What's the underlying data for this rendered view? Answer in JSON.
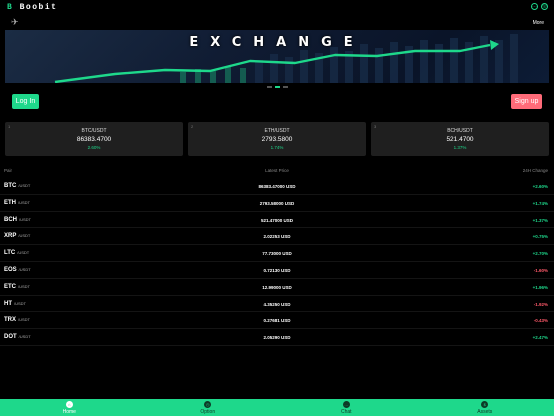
{
  "header": {
    "logo_mark": "B",
    "logo_text": "Boobit",
    "icons": [
      "chat-icon",
      "globe-icon"
    ],
    "rocket_icon": "rocket-icon",
    "more_label": "More"
  },
  "banner": {
    "title": "EXCHANGE",
    "slides": 3,
    "active_slide": 1
  },
  "auth": {
    "login_label": "Log In",
    "signup_label": "Sign up"
  },
  "tickers": [
    {
      "index": "1",
      "pair": "BTC/USDT",
      "price": "86383.4700",
      "change": "2.60%"
    },
    {
      "index": "2",
      "pair": "ETH/USDT",
      "price": "2793.5800",
      "change": "1.74%"
    },
    {
      "index": "3",
      "pair": "BCH/USDT",
      "price": "521.4700",
      "change": "1.37%"
    }
  ],
  "table": {
    "headers": {
      "pair": "Pair",
      "price": "Latest Price",
      "change": "24H Change"
    },
    "rows": [
      {
        "base": "BTC",
        "quote": "/USDT",
        "price": "86383.47000 USD",
        "change": "+2.60%",
        "dir": "up"
      },
      {
        "base": "ETH",
        "quote": "/USDT",
        "price": "2793.58000 USD",
        "change": "+1.74%",
        "dir": "up"
      },
      {
        "base": "BCH",
        "quote": "/USDT",
        "price": "521.47000 USD",
        "change": "+1.37%",
        "dir": "up"
      },
      {
        "base": "XRP",
        "quote": "/USDT",
        "price": "2.02253 USD",
        "change": "+0.75%",
        "dir": "up"
      },
      {
        "base": "LTC",
        "quote": "/USDT",
        "price": "77.73000 USD",
        "change": "+2.70%",
        "dir": "up"
      },
      {
        "base": "EOS",
        "quote": "/USDT",
        "price": "0.72130 USD",
        "change": "-1.60%",
        "dir": "down"
      },
      {
        "base": "ETC",
        "quote": "/USDT",
        "price": "12.99000 USD",
        "change": "+1.96%",
        "dir": "up"
      },
      {
        "base": "HT",
        "quote": "/USDT",
        "price": "4.35250 USD",
        "change": "-1.92%",
        "dir": "down"
      },
      {
        "base": "TRX",
        "quote": "/USDT",
        "price": "0.27681 USD",
        "change": "-0.43%",
        "dir": "down"
      },
      {
        "base": "DOT",
        "quote": "/USDT",
        "price": "2.05290 USD",
        "change": "+2.47%",
        "dir": "up"
      }
    ]
  },
  "tabbar": {
    "tabs": [
      {
        "label": "Home",
        "icon": "home-icon",
        "active": true
      },
      {
        "label": "Option",
        "icon": "option-icon",
        "active": false
      },
      {
        "label": "Chat",
        "icon": "chat-icon",
        "active": false
      },
      {
        "label": "Assets",
        "icon": "assets-icon",
        "active": false
      }
    ]
  },
  "colors": {
    "accent": "#1ed88b",
    "danger": "#ff6b79",
    "background": "#000000"
  }
}
